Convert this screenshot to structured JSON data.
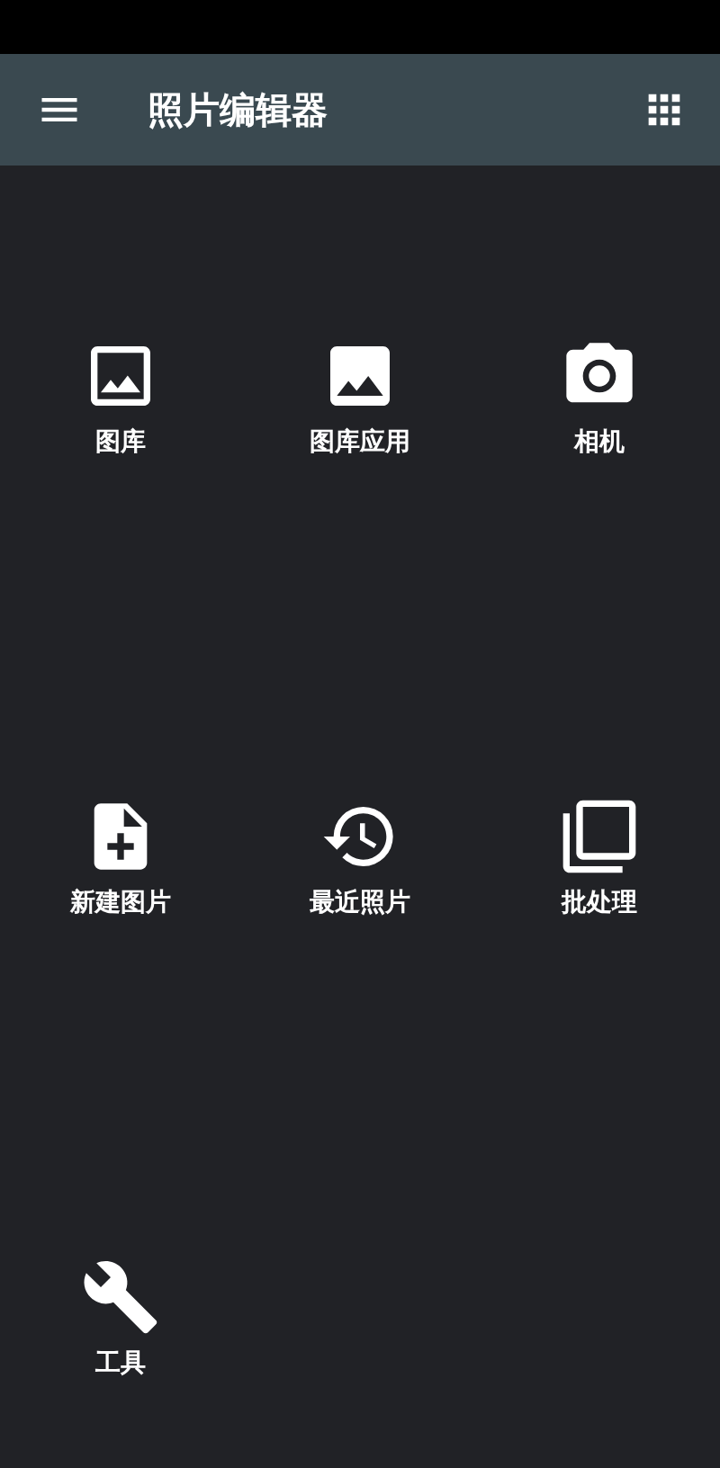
{
  "app_bar": {
    "title": "照片编辑器"
  },
  "tiles": [
    {
      "kind": "gallery",
      "label": "图库"
    },
    {
      "kind": "gallery-app",
      "label": "图库应用"
    },
    {
      "kind": "camera",
      "label": "相机"
    },
    {
      "kind": "new-image",
      "label": "新建图片"
    },
    {
      "kind": "recent",
      "label": "最近照片"
    },
    {
      "kind": "batch",
      "label": "批处理"
    },
    {
      "kind": "tools",
      "label": "工具"
    }
  ]
}
